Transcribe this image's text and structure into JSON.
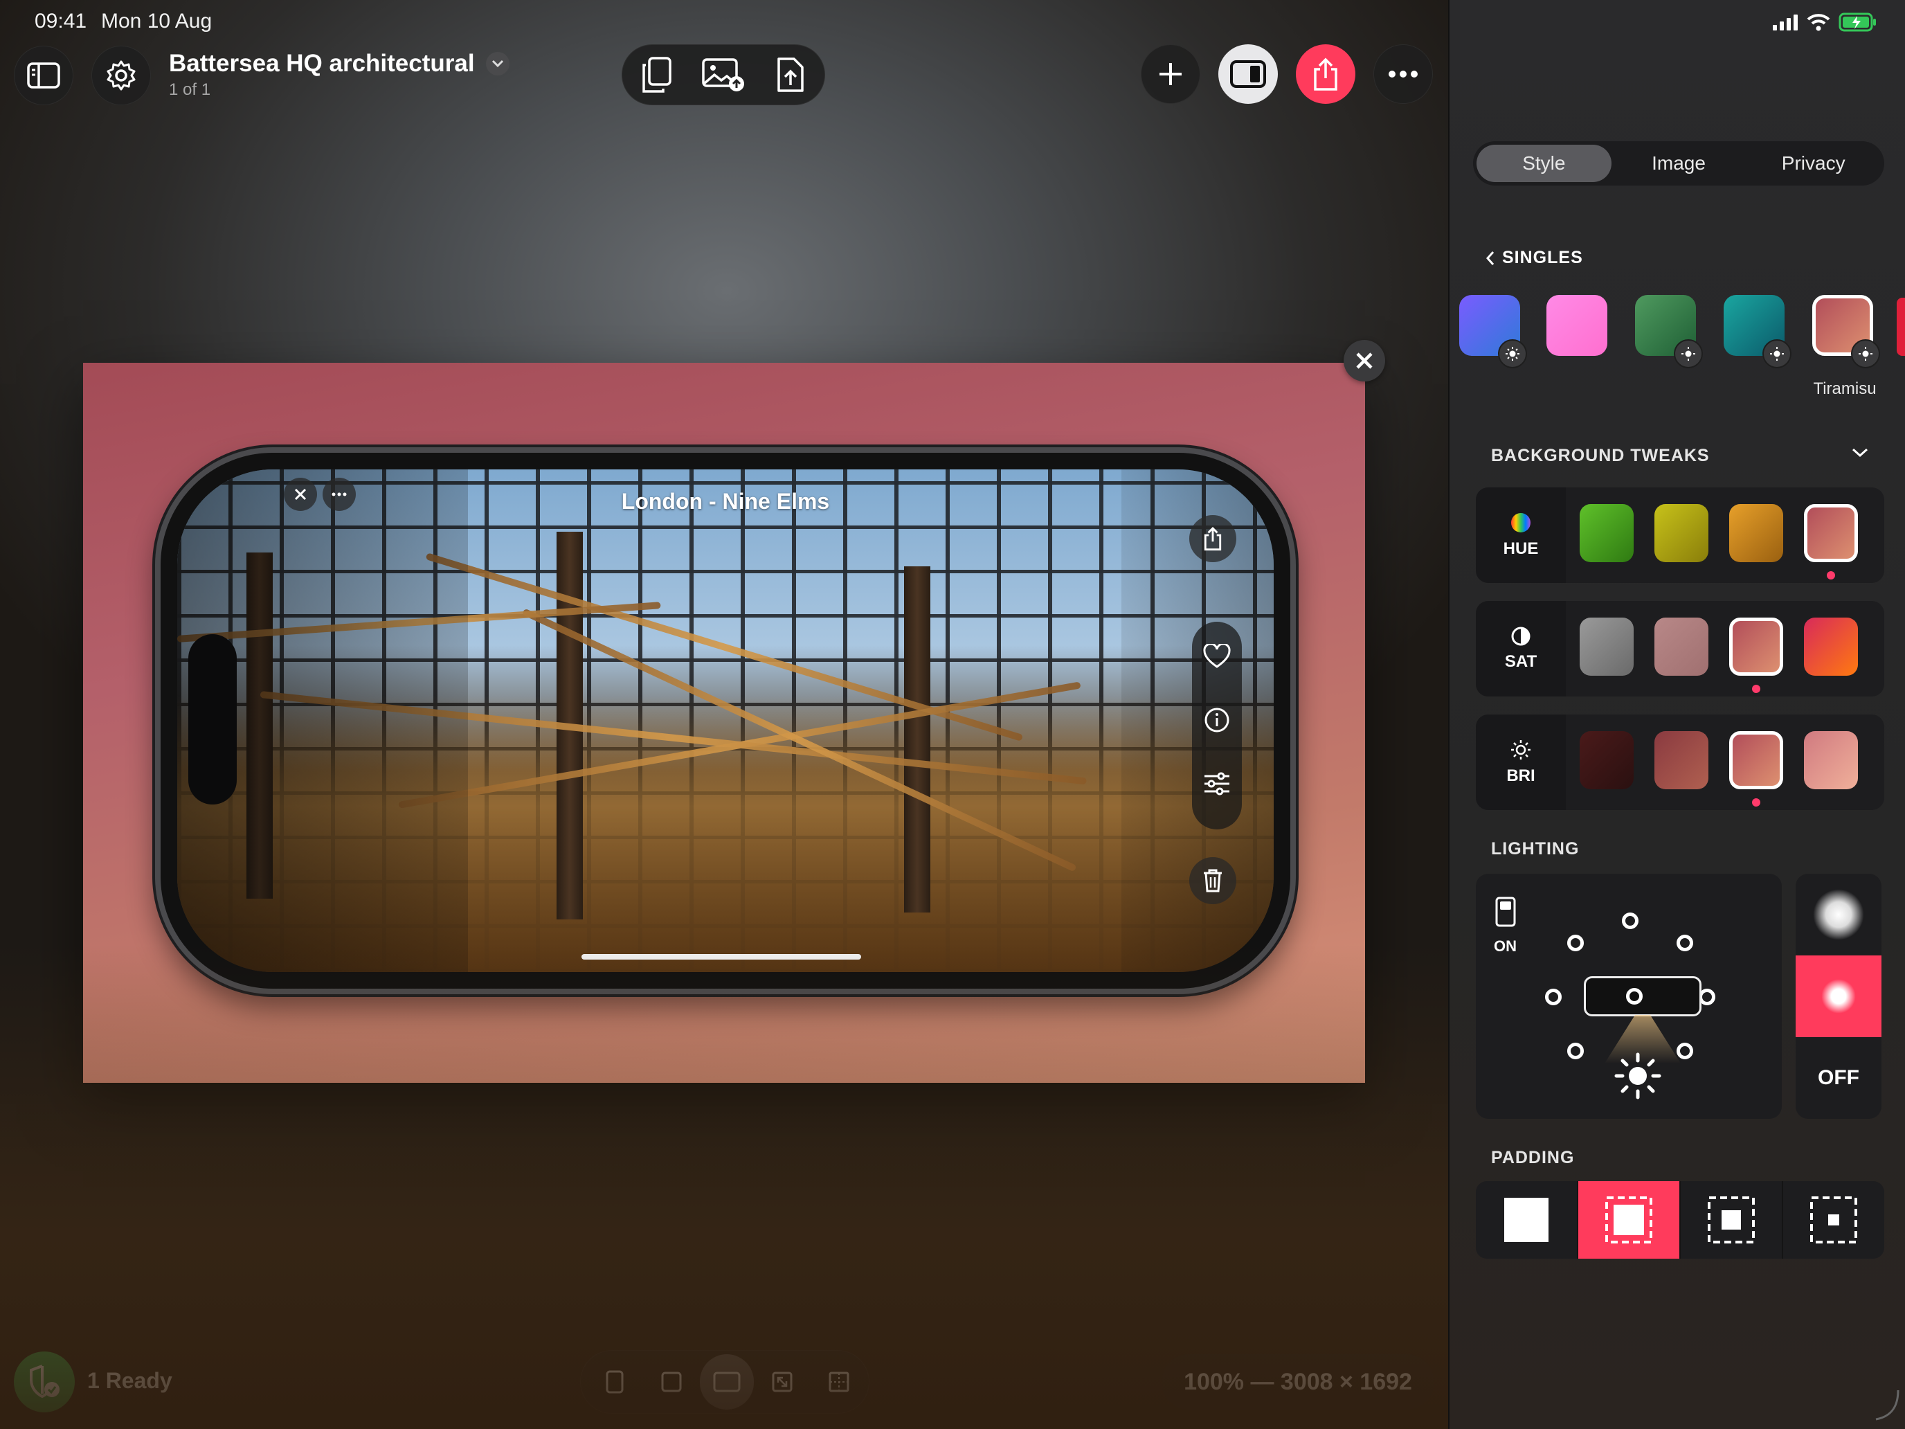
{
  "status_bar": {
    "time": "09:41",
    "date": "Mon 10 Aug",
    "battery_color": "#34c759"
  },
  "header": {
    "title": "Battersea HQ architectural",
    "subtitle": "1 of 1"
  },
  "toolbar": {
    "center_icons": [
      "copy-icon",
      "image-upload-icon",
      "export-file-icon"
    ],
    "right_icons": [
      "plus-icon",
      "layout-panel-icon",
      "share-icon",
      "more-icon"
    ],
    "accent": "#ff3b5c"
  },
  "preview": {
    "phone_title": "London - Nine Elms",
    "background_color": "#b4606a"
  },
  "bottom": {
    "ready_label": "1 Ready",
    "zoom_label": "100% — 3008 × 1692",
    "aspect_icons": [
      "portrait-icon",
      "square-icon",
      "landscape-icon",
      "fit-icon",
      "crop-grid-icon"
    ],
    "active_aspect": 2
  },
  "panel": {
    "tabs": [
      "Style",
      "Image",
      "Privacy"
    ],
    "active_tab": 0,
    "singles_label": "SINGLES",
    "singles": [
      {
        "color": "#4f6ee0"
      },
      {
        "color": "#ff7ee0"
      },
      {
        "color": "#3a8a4f"
      },
      {
        "color": "#0f8a8a"
      },
      {
        "color": "#c7705c",
        "name": "Tiramisu",
        "selected": true
      }
    ],
    "background_tweaks_label": "BACKGROUND TWEAKS",
    "hue_label": "HUE",
    "sat_label": "SAT",
    "bri_label": "BRI",
    "lighting_label": "LIGHTING",
    "lighting_on_label": "ON",
    "lighting_off_label": "OFF",
    "padding_label": "PADDING",
    "active_padding": 1
  }
}
